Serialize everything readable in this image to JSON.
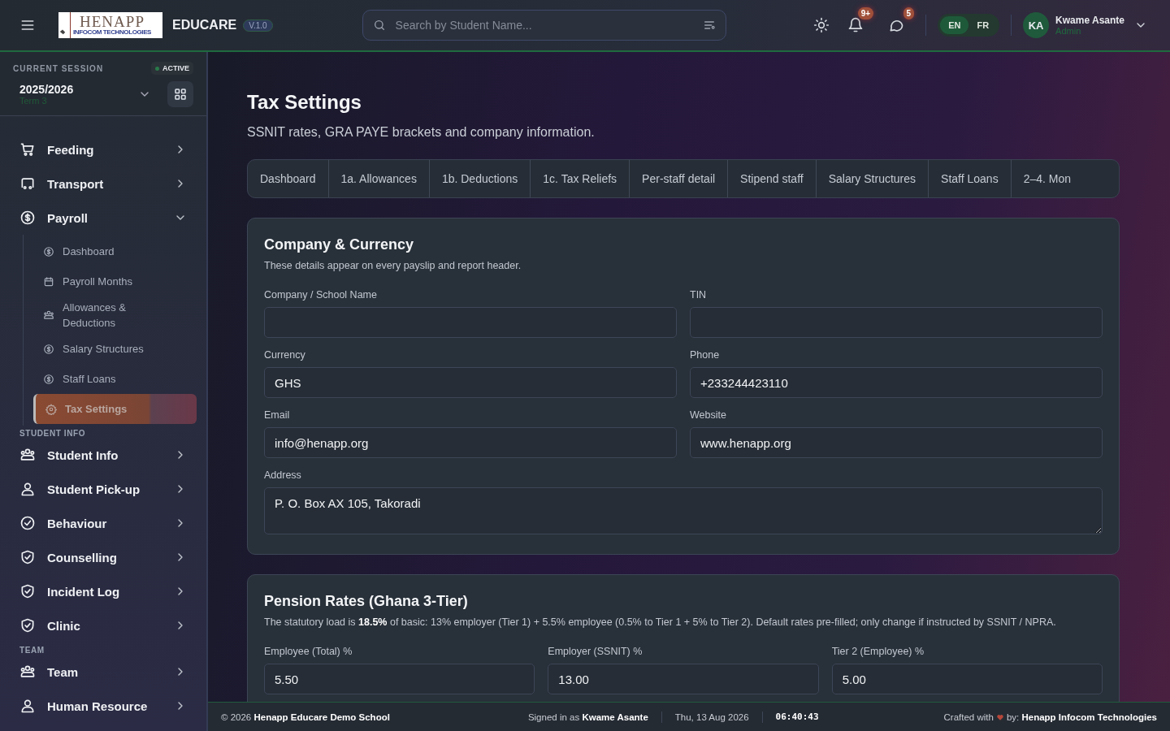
{
  "topbar": {
    "logo": {
      "title": "HENAPP",
      "subtitle": "INFOCOM TECHNOLOGIES"
    },
    "app_name": "EDUCARE",
    "version": "V.1.0",
    "search": {
      "placeholder": "Search by Student Name..."
    },
    "notifications_badge": "9+",
    "messages_badge": "5",
    "languages": [
      {
        "label": "EN",
        "selected": true
      },
      {
        "label": "FR",
        "selected": false
      }
    ],
    "user": {
      "initials": "KA",
      "name": "Kwame Asante",
      "role": "Admin"
    }
  },
  "sidebar": {
    "session": {
      "label": "CURRENT SESSION",
      "status": "ACTIVE",
      "year": "2025/2026",
      "term": "Term 3"
    },
    "groups": [
      {
        "items": [
          {
            "label": "Feeding",
            "expanded": false
          },
          {
            "label": "Transport",
            "expanded": false
          },
          {
            "label": "Payroll",
            "expanded": true,
            "children": [
              {
                "label": "Dashboard",
                "selected": false
              },
              {
                "label": "Payroll Months",
                "selected": false
              },
              {
                "label": "Allowances & Deductions",
                "selected": false
              },
              {
                "label": "Salary Structures",
                "selected": false
              },
              {
                "label": "Staff Loans",
                "selected": false
              },
              {
                "label": "Tax Settings",
                "selected": true
              }
            ]
          }
        ]
      },
      {
        "heading": "STUDENT INFO",
        "items": [
          {
            "label": "Student Info",
            "expanded": false
          },
          {
            "label": "Student Pick-up",
            "expanded": false
          },
          {
            "label": "Behaviour",
            "expanded": false
          },
          {
            "label": "Counselling",
            "expanded": false
          },
          {
            "label": "Incident Log",
            "expanded": false
          },
          {
            "label": "Clinic",
            "expanded": false
          }
        ]
      },
      {
        "heading": "TEAM",
        "items": [
          {
            "label": "Team",
            "expanded": false
          },
          {
            "label": "Human Resource",
            "expanded": false
          }
        ]
      }
    ]
  },
  "page": {
    "title": "Tax Settings",
    "subtitle": "SSNIT rates, GRA PAYE brackets and company information.",
    "tabs": [
      {
        "label": "Dashboard",
        "selected": false
      },
      {
        "label": "1a. Allowances",
        "selected": false
      },
      {
        "label": "1b. Deductions",
        "selected": false
      },
      {
        "label": "1c. Tax Reliefs",
        "selected": false
      },
      {
        "label": "Per-staff detail",
        "selected": false
      },
      {
        "label": "Stipend staff",
        "selected": false
      },
      {
        "label": "Salary Structures",
        "selected": false
      },
      {
        "label": "Staff Loans",
        "selected": false
      },
      {
        "label": "2–4. Mon",
        "selected": false
      }
    ],
    "cards": [
      {
        "title": "Company & Currency",
        "description": "These details appear on every payslip and report header.",
        "fields": [
          {
            "label": "Company / School Name",
            "kind": "input"
          },
          {
            "label": "TIN",
            "kind": "input"
          },
          {
            "label": "Currency",
            "value": "GHS",
            "kind": "input"
          },
          {
            "label": "Phone",
            "value": "+233244423110",
            "kind": "input"
          },
          {
            "label": "Email",
            "value": "info@henapp.org",
            "kind": "input"
          },
          {
            "label": "Website",
            "value": "www.henapp.org",
            "kind": "input"
          },
          {
            "label": "Address",
            "value": "P. O. Box AX 105, Takoradi",
            "kind": "textarea"
          }
        ]
      },
      {
        "title": "Pension Rates (Ghana 3-Tier)",
        "description": "The statutory load is **18.5%** of basic: 13% employer (Tier 1) + 5.5% employee (0.5% to Tier 1 + 5% to Tier 2). Default rates pre-filled; only change if instructed by SSNIT / NPRA.",
        "fields": [
          {
            "label": "Employee (Total) %",
            "value": "5.50",
            "kind": "input"
          },
          {
            "label": "Employer (SSNIT) %",
            "value": "13.00",
            "kind": "input"
          },
          {
            "label": "Tier 2 (Employee) %",
            "value": "5.00",
            "kind": "input"
          }
        ]
      }
    ]
  },
  "footer": {
    "copyright": "© 2026 **Henapp Educare Demo School**",
    "signed_in": "Signed in as **Kwame Asante**",
    "date": "Thu, 13 Aug 2026",
    "time": "06:40:43",
    "credit_prefix": "Crafted with",
    "credit_suffix": "by: **Henapp Infocom Technologies**"
  }
}
